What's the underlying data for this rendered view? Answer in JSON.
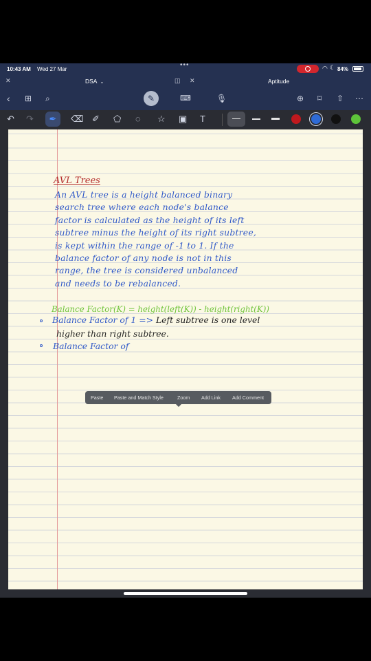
{
  "status_bar": {
    "time": "10:43 AM",
    "date": "Wed 27 Mar",
    "battery": "84%"
  },
  "tabs": [
    {
      "label": "DSA"
    },
    {
      "label": "Aptitude"
    }
  ],
  "note": {
    "title": "AVL Trees",
    "paragraph_lines": [
      "An AVL tree is a height balanced binary",
      "search tree where each node's balance",
      "factor is calculated as the height of its left",
      "subtree minus the height of its right subtree,",
      "is kept within the range of -1 to 1. If the",
      "balance factor of any node is not in this",
      "range, the tree is considered unbalanced",
      "and needs to be rebalanced."
    ],
    "formula": "Balance Factor(K) = height(left(K)) - height(right(K))",
    "bullet1_prefix": "Balance Factor of 1 =>",
    "bullet1_rest": " Left subtree is one level",
    "bullet1_line2": "higher than right subtree.",
    "bullet2": "Balance Factor of"
  },
  "context_menu": {
    "items": [
      "Paste",
      "Paste and Match Style",
      "Zoom",
      "Add Link",
      "Add Comment"
    ]
  },
  "colors": {
    "toolbar": "#253151",
    "pen_blue": "#2f58c8",
    "heading_red": "#b32a2a",
    "formula_green": "#6fc43a",
    "swatch_red": "#c0191e",
    "swatch_blue": "#2f6bd6",
    "swatch_black": "#111111",
    "swatch_green": "#5ec43a"
  }
}
